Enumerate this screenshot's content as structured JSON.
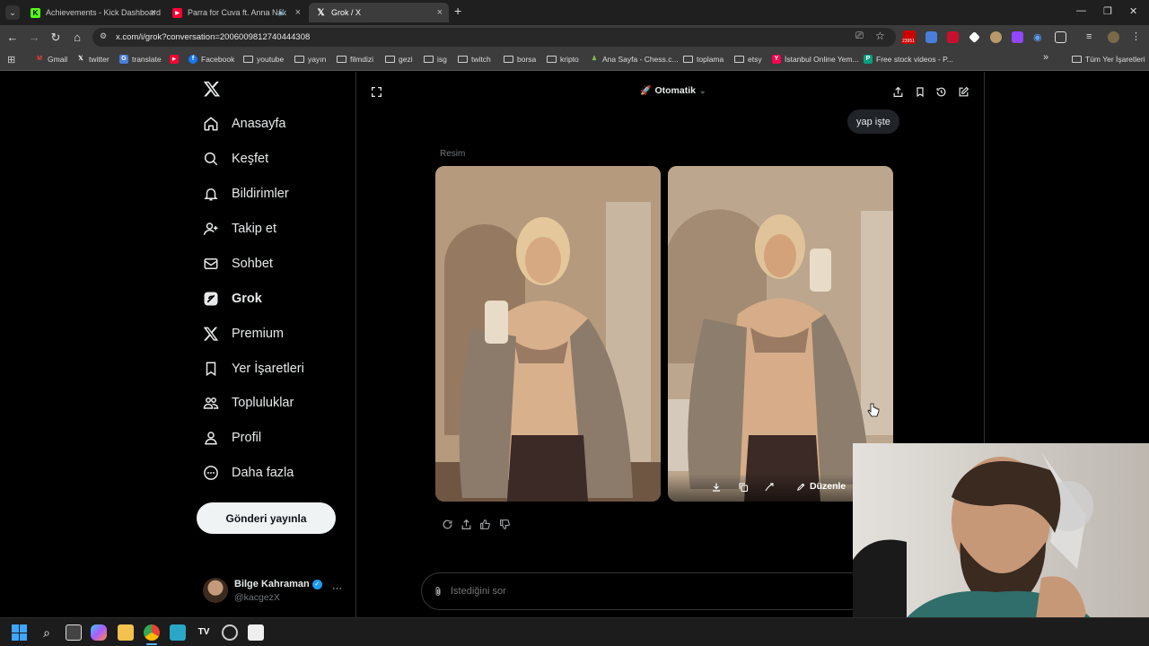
{
  "browser": {
    "tabs": [
      {
        "title": "Achievements - Kick Dashboard",
        "favicon": "kick-icon",
        "color": "#53fc18"
      },
      {
        "title": "Parra for Cuva ft. Anna Nak",
        "favicon": "youtube-icon",
        "color": "#ff0033"
      },
      {
        "title": "Grok / X",
        "favicon": "x-icon",
        "color": "#ffffff"
      }
    ],
    "url": "x.com/i/grok?conversation=2006009812740444308",
    "extension_badge": "23951",
    "bookmarks": [
      {
        "label": "Gmail",
        "icon": "gmail-icon"
      },
      {
        "label": "twitter",
        "icon": "x-icon"
      },
      {
        "label": "translate",
        "icon": "translate-icon"
      },
      {
        "label": "",
        "icon": "youtube-icon"
      },
      {
        "label": "Facebook",
        "icon": "facebook-icon"
      },
      {
        "label": "youtube",
        "icon": "folder-icon"
      },
      {
        "label": "yayın",
        "icon": "folder-icon"
      },
      {
        "label": "filmdizi",
        "icon": "folder-icon"
      },
      {
        "label": "gezi",
        "icon": "folder-icon"
      },
      {
        "label": "isg",
        "icon": "folder-icon"
      },
      {
        "label": "twitch",
        "icon": "folder-icon"
      },
      {
        "label": "borsa",
        "icon": "folder-icon"
      },
      {
        "label": "kripto",
        "icon": "folder-icon"
      },
      {
        "label": "Ana Sayfa - Chess.c...",
        "icon": "chess-icon"
      },
      {
        "label": "toplama",
        "icon": "folder-icon"
      },
      {
        "label": "etsy",
        "icon": "folder-icon"
      },
      {
        "label": "İstanbul Online Yem...",
        "icon": "yemeksepeti-icon"
      },
      {
        "label": "Free stock videos - P...",
        "icon": "pexels-icon"
      }
    ],
    "all_bookmarks": "Tüm Yer İşaretleri",
    "more_bookmarks": "»"
  },
  "sidebar": {
    "items": [
      {
        "label": "Anasayfa",
        "icon": "home-icon"
      },
      {
        "label": "Keşfet",
        "icon": "search-icon"
      },
      {
        "label": "Bildirimler",
        "icon": "bell-icon"
      },
      {
        "label": "Takip et",
        "icon": "follow-icon"
      },
      {
        "label": "Sohbet",
        "icon": "mail-icon"
      },
      {
        "label": "Grok",
        "icon": "grok-icon"
      },
      {
        "label": "Premium",
        "icon": "x-icon"
      },
      {
        "label": "Yer İşaretleri",
        "icon": "bookmark-icon"
      },
      {
        "label": "Topluluklar",
        "icon": "communities-icon"
      },
      {
        "label": "Profil",
        "icon": "profile-icon"
      },
      {
        "label": "Daha fazla",
        "icon": "more-icon"
      }
    ],
    "post_button": "Gönderi yayınla",
    "user": {
      "name": "Bilge Kahraman",
      "handle": "@kacgezX",
      "more": "···"
    }
  },
  "grok": {
    "mode": "Otomatik",
    "user_message": "yap işte",
    "image_section_label": "Resim",
    "edit_label": "Düzenle",
    "ask_placeholder": "İstediğini sor"
  },
  "colors": {
    "accent_blue": "#1d9bf0",
    "background": "#000000",
    "border": "#2f3336"
  }
}
